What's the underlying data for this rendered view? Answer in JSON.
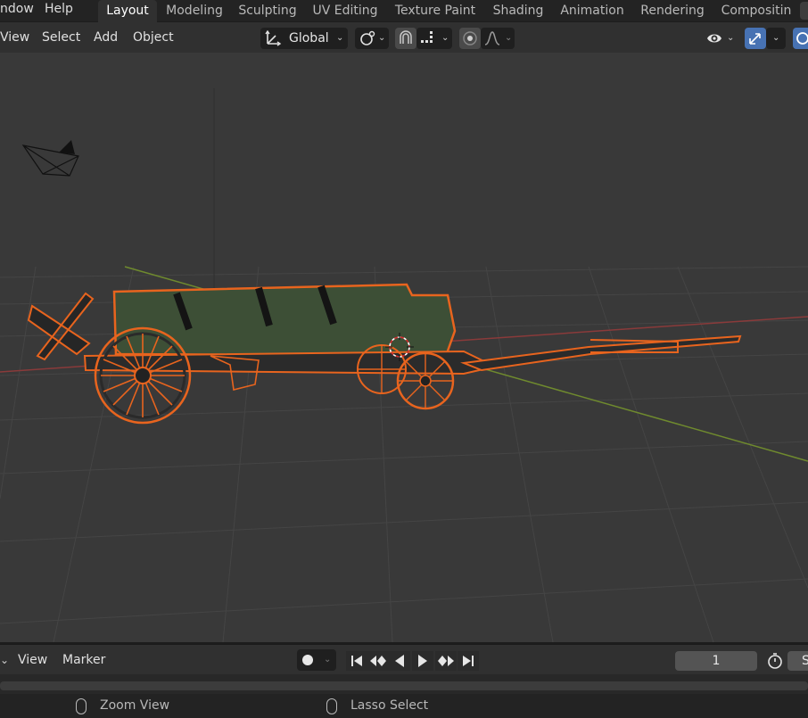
{
  "topbar": {
    "menus": [
      "ndow",
      "Help"
    ],
    "workspace_tabs": [
      "Layout",
      "Modeling",
      "Sculpting",
      "UV Editing",
      "Texture Paint",
      "Shading",
      "Animation",
      "Rendering",
      "Compositin"
    ],
    "active_tab": "Layout"
  },
  "viewport_header": {
    "menus": [
      "View",
      "Select",
      "Add",
      "Object"
    ],
    "transform_orientation": "Global",
    "icons": [
      "transform-orientation-icon",
      "pivot-point-icon",
      "snap-icon",
      "snap-increment-icon",
      "proportional-edit-icon",
      "falloff-icon",
      "visibility-icon",
      "gizmo-icon",
      "overlay-icon"
    ]
  },
  "timeline": {
    "menus": [
      "View",
      "Marker"
    ],
    "current_frame": "1",
    "start_label": "S",
    "playback_icons": [
      "jump-start-icon",
      "prev-keyframe-icon",
      "play-reverse-icon",
      "play-icon",
      "next-keyframe-icon",
      "jump-end-icon"
    ]
  },
  "statusbar": {
    "items": [
      "Zoom View",
      "Lasso Select"
    ]
  },
  "colors": {
    "selection_outline": "#e8641e",
    "wagon_cover": "#3d4f36",
    "x_axis": "#8a3a3a",
    "y_axis": "#6f8a2e",
    "active_tab_bg": "#303030",
    "accent_blue": "#4772b3"
  }
}
